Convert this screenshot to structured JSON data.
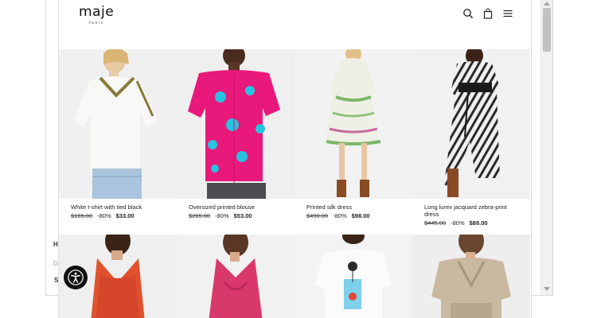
{
  "background_page": {
    "fragments": [
      "H",
      "D",
      "S"
    ]
  },
  "header": {
    "logo": "maje",
    "logo_sub": "PARIS"
  },
  "icons": {
    "search": "search-icon",
    "bag": "shopping-bag-icon",
    "menu": "hamburger-menu-icon",
    "accessibility": "accessibility-icon"
  },
  "products": [
    {
      "name": "White t-shirt with tied black",
      "old_price": "$165.00",
      "discount": "-80%",
      "price": "$33.00"
    },
    {
      "name": "Oversized printed blouse",
      "old_price": "$265.00",
      "discount": "-80%",
      "price": "$53.00"
    },
    {
      "name": "Printed silk dress",
      "old_price": "$490.00",
      "discount": "-80%",
      "price": "$98.00"
    },
    {
      "name": "Long lurex jacquard zebra-print dress",
      "old_price": "$445.00",
      "discount": "-80%",
      "price": "$89.00"
    }
  ],
  "colors": {
    "blouse_pink": "#e8197a",
    "print_blue": "#27c2e0",
    "dark": "#111111"
  }
}
